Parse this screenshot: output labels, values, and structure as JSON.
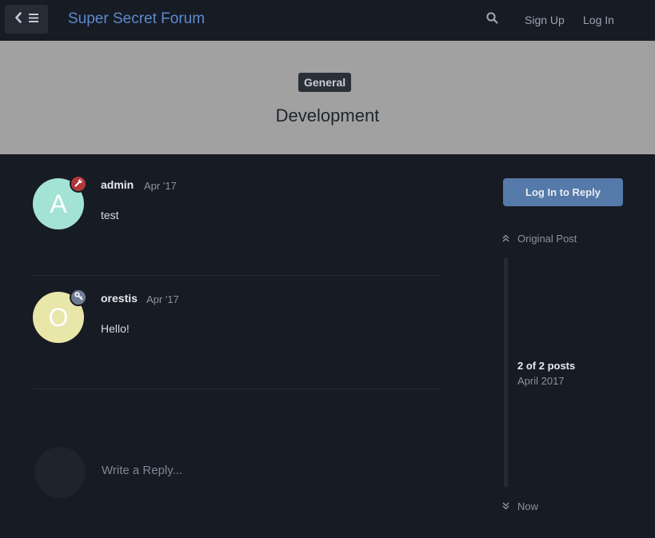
{
  "header": {
    "forum_title": "Super Secret Forum",
    "sign_up": "Sign Up",
    "log_in": "Log In"
  },
  "hero": {
    "tag": "General",
    "title": "Development"
  },
  "posts": [
    {
      "avatar_letter": "A",
      "avatar_color": "#a3e3d4",
      "badge_color": "#b3383b",
      "badge_icon": "wrench-icon",
      "username": "admin",
      "date": "Apr '17",
      "body": "test"
    },
    {
      "avatar_letter": "O",
      "avatar_color": "#e9e6a9",
      "badge_color": "#6f7c95",
      "badge_icon": "key-icon",
      "username": "orestis",
      "date": "Apr '17",
      "body": "Hello!"
    }
  ],
  "composer": {
    "placeholder": "Write a Reply..."
  },
  "sidebar": {
    "reply_button": "Log In to Reply",
    "original_post": "Original Post",
    "count": "2 of 2 posts",
    "date": "April 2017",
    "now": "Now"
  }
}
